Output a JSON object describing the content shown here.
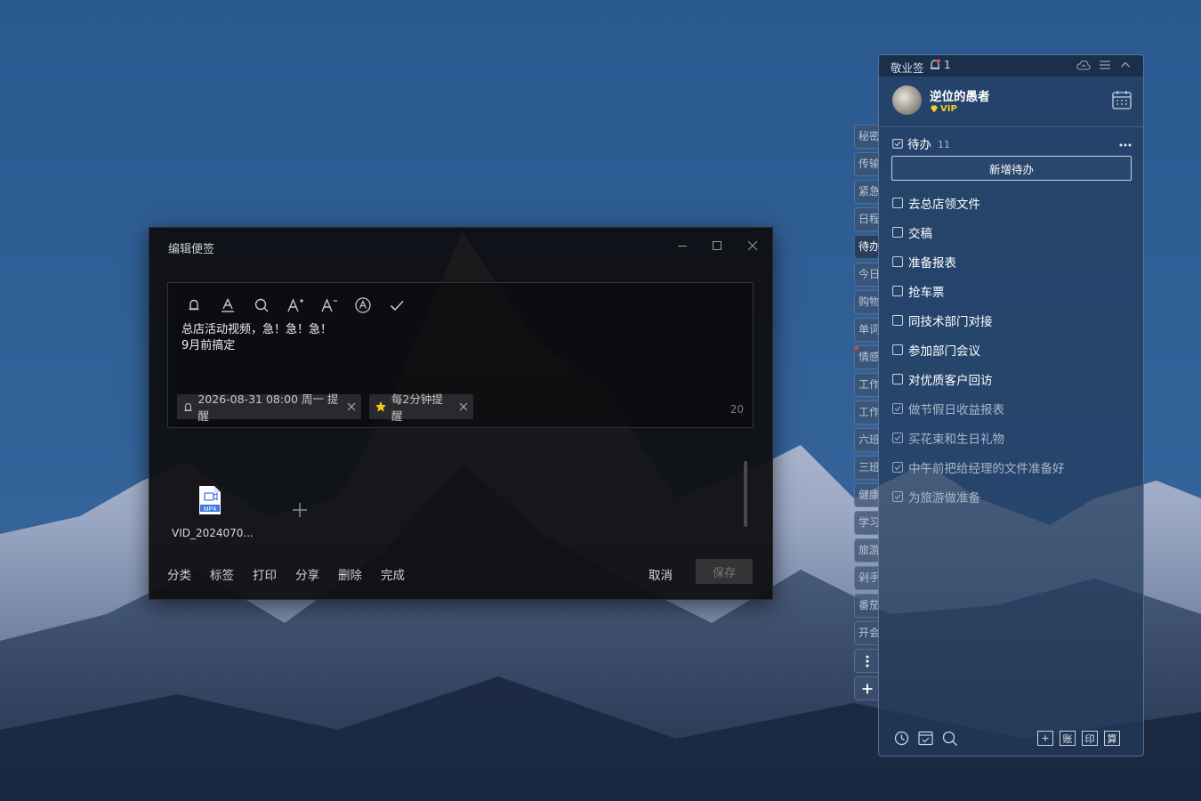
{
  "editor": {
    "title": "编辑便签",
    "toolbar": [
      "bell-icon",
      "text-color-icon",
      "search-icon",
      "font-increase-icon",
      "font-decrease-icon",
      "autocorrect-icon",
      "check-icon"
    ],
    "note_lines": [
      "总店活动视频，急！急！急！",
      "9月前搞定"
    ],
    "reminder_chip": "2026-08-31 08:00 周一 提醒",
    "repeat_chip": "每2分钟提醒",
    "char_count": "20",
    "attachment": {
      "type_label": "MP4",
      "name": "VID_2024070..."
    },
    "bottom_actions": [
      "分类",
      "标签",
      "打印",
      "分享",
      "删除",
      "完成"
    ],
    "cancel": "取消",
    "save": "保存"
  },
  "side_tabs": [
    "秘密",
    "传输",
    "紧急",
    "日程",
    "待办",
    "今日",
    "购物",
    "单词",
    "情感",
    "工作",
    "工作",
    "六班",
    "三班",
    "健康",
    "学习",
    "旅游",
    "剁手",
    "番茄",
    "开会"
  ],
  "side_tabs_active": "待办",
  "panel": {
    "app_name": "敬业签",
    "notif_count": "1",
    "username": "逆位的愚者",
    "vip": "VIP",
    "todo_title": "待办",
    "todo_count": "11",
    "new_todo": "新增待办",
    "todos_open": [
      "去总店领文件",
      "交稿",
      "准备报表",
      "抢车票",
      "同技术部门对接",
      "参加部门会议",
      "对优质客户回访"
    ],
    "todos_done": [
      "做节假日收益报表",
      "买花束和生日礼物",
      "中午前把给经理的文件准备好",
      "为旅游做准备"
    ],
    "footer_boxes": [
      "+",
      "账",
      "印",
      "算"
    ]
  },
  "colors": {
    "editor_bg": "#0e0e10",
    "panel_bg": "#223a5a",
    "vip": "#f3cf2a",
    "star": "#f5c518"
  }
}
